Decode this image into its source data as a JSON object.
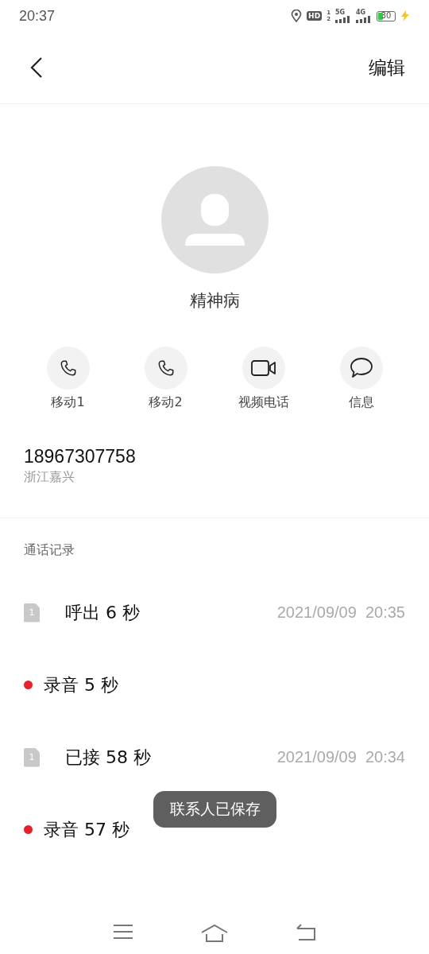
{
  "status_bar": {
    "time": "20:37",
    "hd": "HD",
    "sim_slots": [
      "1",
      "2"
    ],
    "networks": [
      "5G",
      "4G"
    ],
    "battery": "30"
  },
  "header": {
    "edit": "编辑"
  },
  "contact": {
    "name": "精神病"
  },
  "actions": [
    {
      "kind": "phone",
      "label": "移动1"
    },
    {
      "kind": "phone",
      "label": "移动2"
    },
    {
      "kind": "video",
      "label": "视频电话"
    },
    {
      "kind": "message",
      "label": "信息"
    }
  ],
  "number": {
    "value": "18967307758",
    "location": "浙江嘉兴"
  },
  "call_log": {
    "title": "通话记录",
    "rows": [
      {
        "kind": "call",
        "sim": "1",
        "label": "呼出 6 秒",
        "time": "2021/09/09  20:35"
      },
      {
        "kind": "recording",
        "color": "#e8202a",
        "label": "录音 5 秒"
      },
      {
        "kind": "call",
        "sim": "1",
        "label": "已接 58 秒",
        "time": "2021/09/09  20:34"
      },
      {
        "kind": "recording",
        "color": "#e8202a",
        "label": "录音 57 秒"
      }
    ]
  },
  "toast": "联系人已保存"
}
